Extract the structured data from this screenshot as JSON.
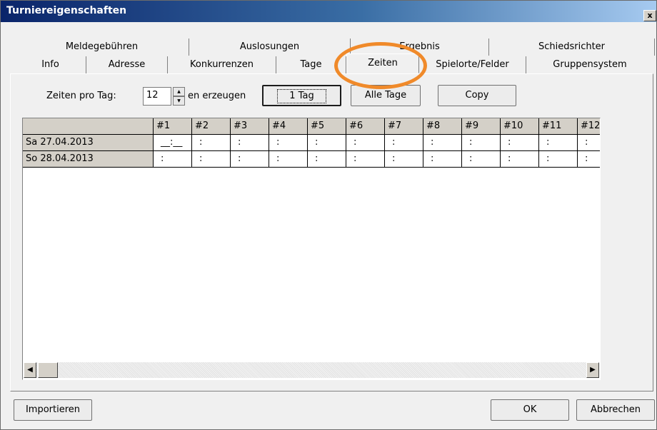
{
  "window": {
    "title": "Turniereigenschaften",
    "close_label": "x"
  },
  "tabs_row1": [
    "Meldegebühren",
    "Auslosungen",
    "Ergebnis",
    "Schiedsrichter"
  ],
  "tabs_row2": [
    "Info",
    "Adresse",
    "Konkurrenzen",
    "Tage",
    "Zeiten",
    "Spielorte/Felder",
    "Gruppensystem"
  ],
  "selected_tab": "Zeiten",
  "controls": {
    "zeiten_label": "Zeiten pro Tag:",
    "zeiten_value": "12",
    "erzeugen_label": "en erzeugen",
    "btn_one_day": "1 Tag",
    "btn_all_days": "Alle Tage",
    "btn_copy": "Copy"
  },
  "grid": {
    "columns": [
      "#1",
      "#2",
      "#3",
      "#4",
      "#5",
      "#6",
      "#7",
      "#8",
      "#9",
      "#10",
      "#11",
      "#12"
    ],
    "rows": [
      {
        "label": "Sa 27.04.2013",
        "cells": [
          "__:__",
          ":",
          ":",
          ":",
          ":",
          ":",
          ":",
          ":",
          ":",
          ":",
          ":",
          ":"
        ]
      },
      {
        "label": "So 28.04.2013",
        "cells": [
          ":",
          ":",
          ":",
          ":",
          ":",
          ":",
          ":",
          ":",
          ":",
          ":",
          ":",
          ":"
        ]
      }
    ]
  },
  "footer": {
    "import_label": "Importieren",
    "ok_label": "OK",
    "cancel_label": "Abbrechen"
  },
  "colors": {
    "highlight": "#f08a2a",
    "titlebar": "#0a246a"
  }
}
